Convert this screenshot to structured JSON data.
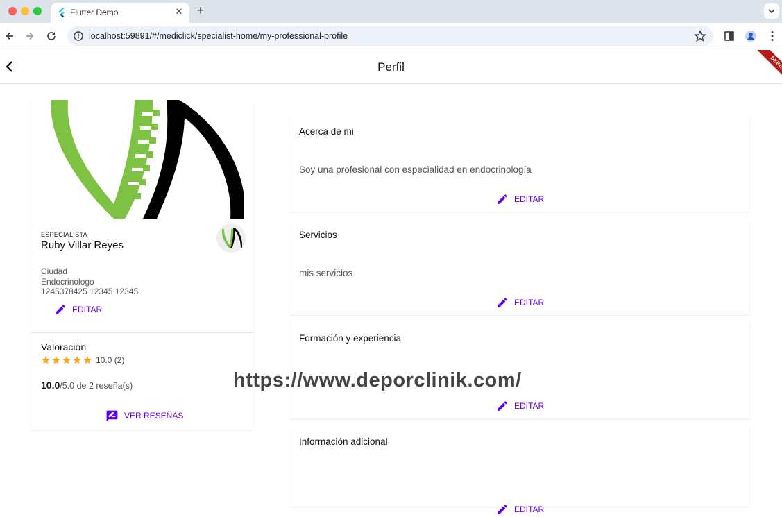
{
  "browser": {
    "tab_title": "Flutter Demo",
    "tab_close": "✕",
    "new_tab": "+",
    "url": "localhost:59891/#/mediclick/specialist-home/my-professional-profile"
  },
  "app": {
    "title": "Perfil",
    "debug_banner": "DEBUG"
  },
  "profile": {
    "role": "ESPECIALISTA",
    "name": "Ruby Villar Reyes",
    "city": "Ciudad",
    "specialty": "Endocrinologo",
    "ids": "1245378425 12345 12345",
    "edit_label": "EDITAR"
  },
  "rating": {
    "title": "Valoración",
    "stars": 5,
    "stars_text": "10.0 (2)",
    "score_bold": "10.0",
    "score_rest": "/5.0 de 2 reseña(s)",
    "reviews_button": "VER RESEÑAS"
  },
  "sections": [
    {
      "title": "Acerca de mi",
      "body": "Soy una profesional con especialidad en endocrinología",
      "edit_label": "EDITAR"
    },
    {
      "title": "Servicios",
      "body": "mis servicios",
      "edit_label": "EDITAR"
    },
    {
      "title": "Formación y experiencia",
      "body": "",
      "edit_label": "EDITAR"
    },
    {
      "title": "Información adicional",
      "body": "",
      "edit_label": "EDITAR"
    }
  ],
  "watermark": "https://www.deporclinik.com/",
  "colors": {
    "accent": "#6200ee",
    "star": "#f5a623",
    "logo_green": "#7dc242",
    "debug": "#b71c1c"
  }
}
